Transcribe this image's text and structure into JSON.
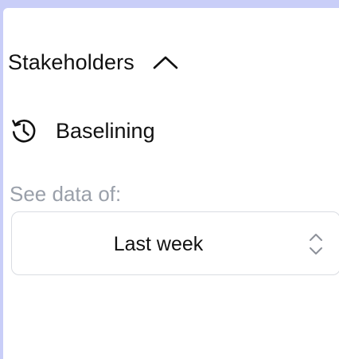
{
  "section": {
    "title": "Stakeholders",
    "toggle_icon": "chevron-up-icon"
  },
  "baselining": {
    "icon": "history-icon",
    "label": "Baselining"
  },
  "data_range": {
    "label": "See data of:",
    "selected": "Last week",
    "indicator_icon": "updown-chevron-icon"
  },
  "colors": {
    "background": "#c9cef8",
    "panel": "#ffffff",
    "text": "#111111",
    "muted_text": "#9aa0aa",
    "border": "#d9dce2"
  }
}
